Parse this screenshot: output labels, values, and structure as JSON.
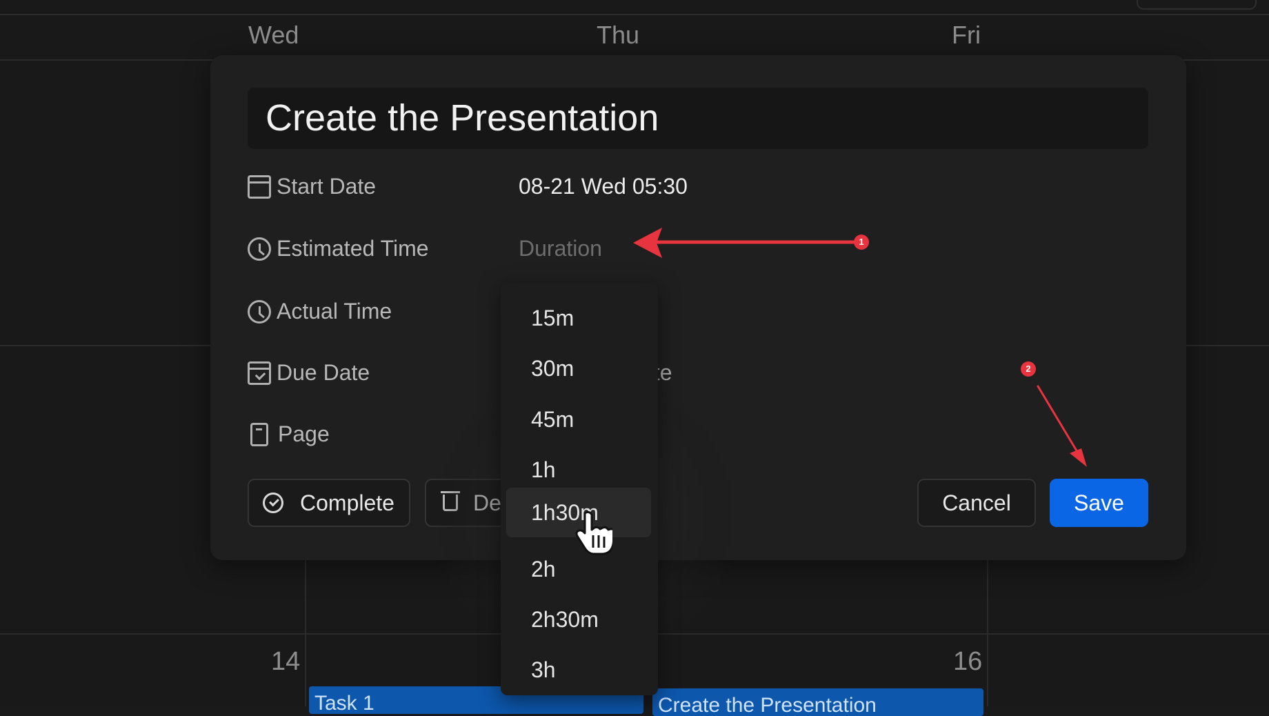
{
  "calendar": {
    "days": [
      "Wed",
      "Thu",
      "Fri"
    ],
    "date_numbers": [
      "14",
      "16"
    ],
    "events": [
      {
        "title": "Task 1"
      },
      {
        "title": "Create the Presentation"
      }
    ]
  },
  "modal": {
    "title": "Create the Presentation",
    "fields": {
      "start_date": {
        "label": "Start Date",
        "value": "08-21 Wed 05:30"
      },
      "estimated_time": {
        "label": "Estimated Time",
        "placeholder": "Duration"
      },
      "actual_time": {
        "label": "Actual Time"
      },
      "due_date": {
        "label": "Due Date",
        "partial_value": "ate"
      },
      "page": {
        "label": "Page"
      }
    },
    "buttons": {
      "complete": "Complete",
      "delete_partial": "De",
      "cancel": "Cancel",
      "save": "Save"
    }
  },
  "duration_dropdown": {
    "options": [
      "15m",
      "30m",
      "45m",
      "1h",
      "1h30m",
      "2h",
      "2h30m",
      "3h"
    ],
    "hovered": "1h30m"
  },
  "annotations": {
    "badge_1": "1",
    "badge_2": "2",
    "color": "#e8343f"
  },
  "colors": {
    "accent": "#0a66e4",
    "event": "#0d57ad",
    "background": "#191919"
  }
}
